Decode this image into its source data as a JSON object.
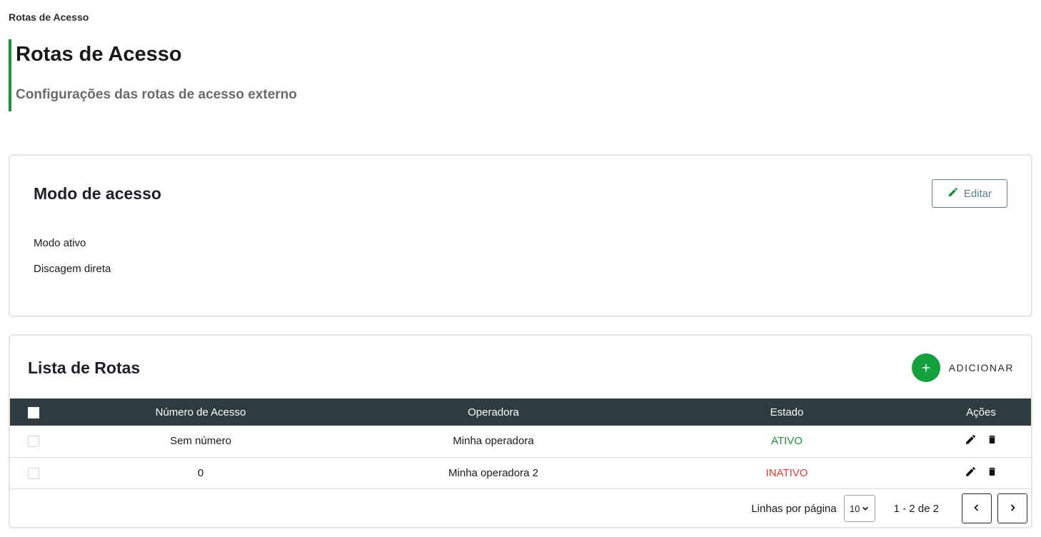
{
  "breadcrumb": "Rotas de Acesso",
  "header": {
    "title": "Rotas de Acesso",
    "subtitle": "Configurações das rotas de acesso externo"
  },
  "mode_card": {
    "title": "Modo de acesso",
    "edit_label": "Editar",
    "lines": [
      "Modo ativo",
      "Discagem direta"
    ]
  },
  "list_card": {
    "title": "Lista de Rotas",
    "add_label": "ADICIONAR",
    "columns": [
      "Número de Acesso",
      "Operadora",
      "Estado",
      "Ações"
    ],
    "rows": [
      {
        "number": "Sem número",
        "operator": "Minha operadora",
        "state": "ATIVO",
        "state_color": "#1e8e3e"
      },
      {
        "number": "0",
        "operator": "Minha operadora 2",
        "state": "INATIVO",
        "state_color": "#e53935"
      }
    ],
    "pagination": {
      "rows_label": "Linhas por página",
      "rows_value": "10",
      "range": "1 - 2 de 2"
    }
  },
  "colors": {
    "accent": "#1e8e3e",
    "add_button": "#14a03c",
    "table_header": "#2e3b3f",
    "inactive": "#e53935"
  },
  "icons": [
    "pencil-icon",
    "plus-icon",
    "trash-icon",
    "chevron-down-icon",
    "chevron-left-icon",
    "chevron-right-icon"
  ]
}
